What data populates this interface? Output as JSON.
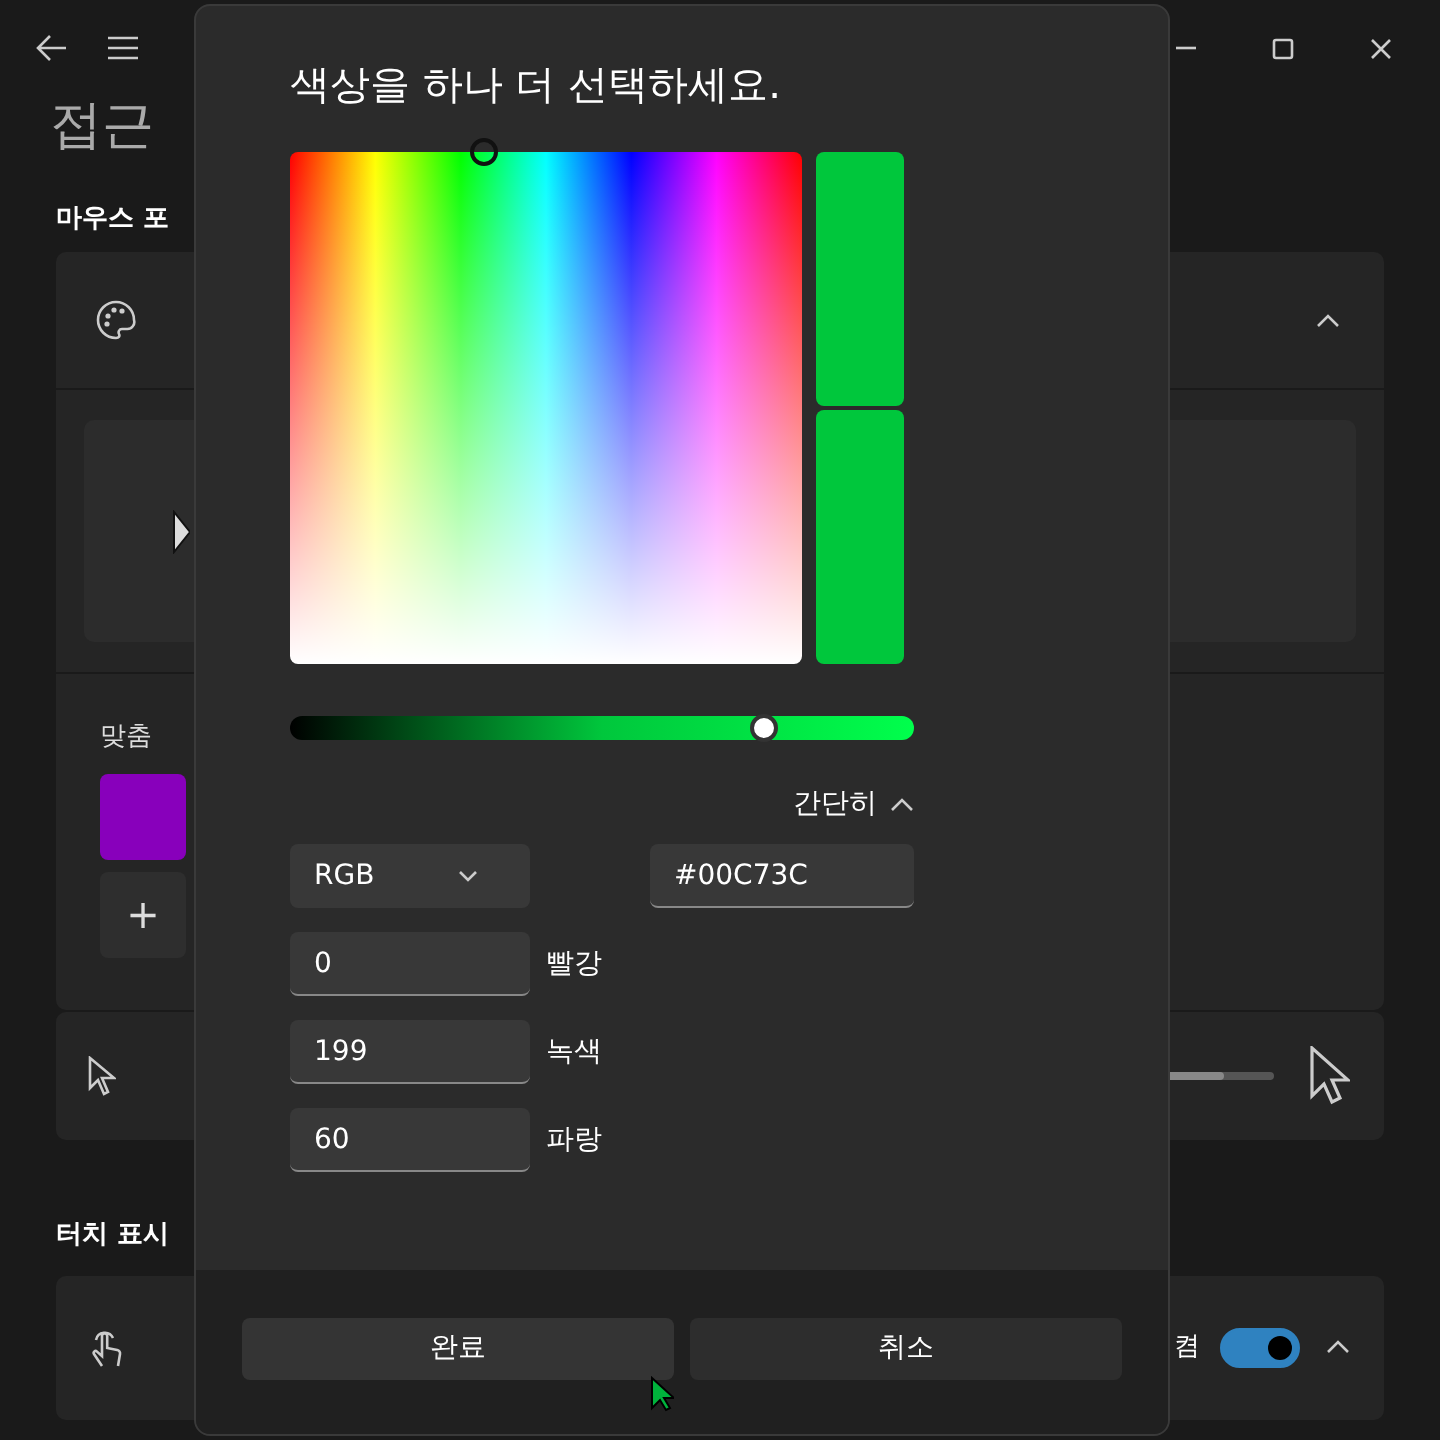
{
  "page": {
    "title": "접근"
  },
  "sections": [
    {
      "heading": "마우스 포"
    },
    {
      "heading": "터치 표시"
    }
  ],
  "pointer_card": {
    "expanded": true,
    "custom_label": "맞춤",
    "custom_colors": [
      {
        "color": "#8800bb"
      }
    ],
    "add_label": "+"
  },
  "size_row": {
    "level": 0.55
  },
  "touch_row": {
    "state_label": "켬",
    "on": true,
    "expanded": true
  },
  "dialog": {
    "title": "색상을 하나 더 선택하세요.",
    "spectrum_thumb": {
      "level": 0.38
    },
    "preview": [
      {
        "color": "#00c73c"
      },
      {
        "color": "#00c73c"
      }
    ],
    "value_slider": {
      "level": 0.76
    },
    "more_toggle": {
      "label": "간단히",
      "expanded": true
    },
    "mode": {
      "value": "RGB"
    },
    "hex": {
      "value": "#00C73C"
    },
    "channels": [
      {
        "value": "0",
        "label": "빨강"
      },
      {
        "value": "199",
        "label": "녹색"
      },
      {
        "value": "60",
        "label": "파랑"
      }
    ],
    "buttons": [
      {
        "label": "완료",
        "kind": "primary"
      },
      {
        "label": "취소",
        "kind": "secondary"
      }
    ]
  }
}
